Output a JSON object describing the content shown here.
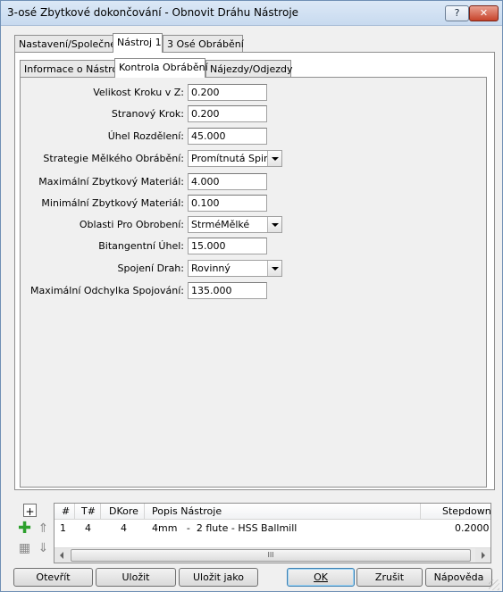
{
  "window": {
    "title": "3-osé Zbytkové dokončování - Obnovit Dráhu Nástroje",
    "help_label": "?",
    "close_label": "✕"
  },
  "outer_tabs": [
    {
      "label": "Nastavení/Společné",
      "active": false
    },
    {
      "label": "Nástroj 1",
      "active": true
    },
    {
      "label": "3 Osé Obrábění",
      "active": false
    }
  ],
  "inner_tabs": [
    {
      "label": "Informace o Nástroji",
      "active": false
    },
    {
      "label": "Kontrola Obrábění",
      "active": true
    },
    {
      "label": "Nájezdy/Odjezdy",
      "active": false
    }
  ],
  "form": {
    "step_z": {
      "label": "Velikost Kroku v Z:",
      "value": "0.200"
    },
    "stepover": {
      "label": "Stranový Krok:",
      "value": "0.200"
    },
    "split_angle": {
      "label": "Úhel Rozdělení:",
      "value": "45.000"
    },
    "shallow_strategy": {
      "label": "Strategie Mělkého Obrábění:",
      "value": "Promítnutá Spirála"
    },
    "max_stock": {
      "label": "Maximální Zbytkový Materiál:",
      "value": "4.000"
    },
    "min_stock": {
      "label": "Minimální Zbytkový Materiál:",
      "value": "0.100"
    },
    "regions": {
      "label": "Oblasti Pro Obrobení:",
      "value": "StrméMělké"
    },
    "bitangent": {
      "label": "Bitangentní Úhel:",
      "value": "15.000"
    },
    "link_paths": {
      "label": "Spojení Drah:",
      "value": "Rovinný"
    },
    "max_link_dev": {
      "label": "Maximální Odchylka Spojování:",
      "value": "135.000"
    }
  },
  "tool_table": {
    "headers": {
      "num": "#",
      "tnum": "T#",
      "dcore": "DKore",
      "desc": "Popis Nástroje",
      "stepdown": "Stepdown"
    },
    "rows": [
      {
        "num": "1",
        "tnum": "4",
        "dcore": "4",
        "desc": "4mm   -  2 flute - HSS Ballmill",
        "stepdown": "0.2000"
      }
    ],
    "scroll_grip": "III"
  },
  "buttons": {
    "open": "Otevřít",
    "save": "Uložit",
    "save_as": "Uložit jako",
    "ok": "OK",
    "cancel": "Zrušit",
    "help": "Nápověda"
  }
}
